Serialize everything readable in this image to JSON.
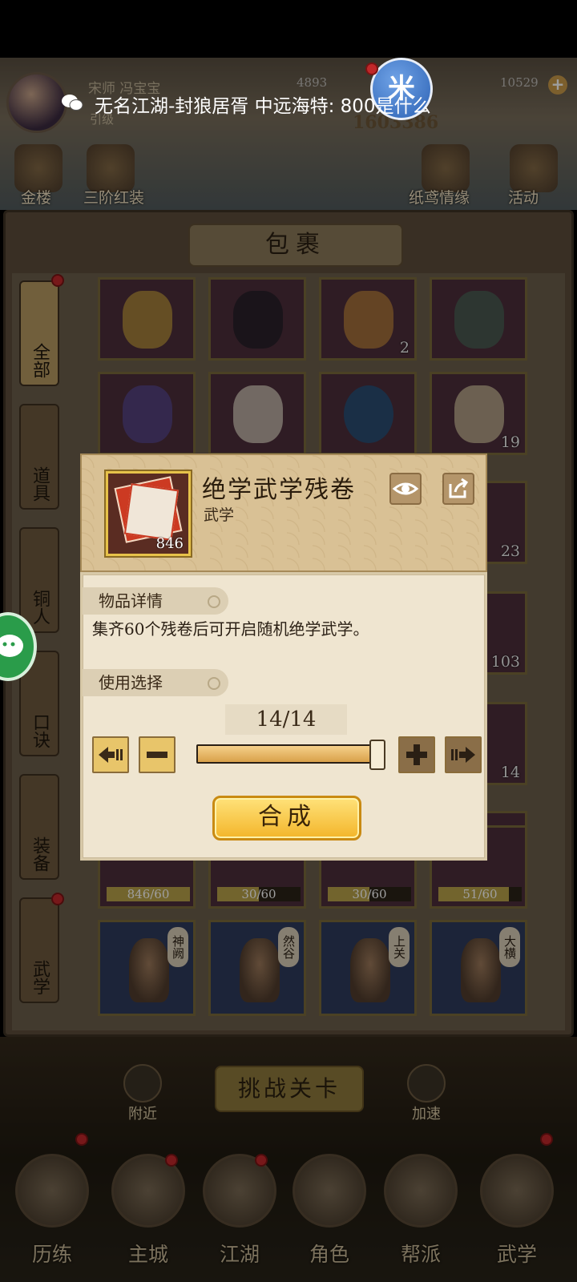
{
  "header": {
    "player_name": "宋师 冯宝宝",
    "player_level": "引级",
    "power": "1603386",
    "coins": "4893",
    "ingots": "10529",
    "float_ball_label": "米",
    "top_icons": [
      "金楼",
      "三阶红装",
      "纸鸢情缘",
      "活动"
    ]
  },
  "notice": {
    "text": "无名江湖-封狼居胥  中远海特: 800是什么"
  },
  "bag": {
    "title": "包裹",
    "tabs": [
      {
        "label": "全部",
        "active": true
      },
      {
        "label": "道具",
        "active": false
      },
      {
        "label": "铜人",
        "active": false
      },
      {
        "label": "口诀",
        "active": false
      },
      {
        "label": "装备",
        "active": false
      },
      {
        "label": "武学",
        "active": false
      }
    ],
    "slots_row1": [
      "",
      "",
      "2",
      ""
    ],
    "slots_row2": [
      "",
      "",
      "",
      "19"
    ],
    "side_counts": [
      "23",
      "103",
      "14"
    ],
    "progress_row": [
      {
        "text": "846/60",
        "fraction": 1.0
      },
      {
        "text": "30/60",
        "fraction": 0.5
      },
      {
        "text": "30/60",
        "fraction": 0.5
      },
      {
        "text": "51/60",
        "fraction": 0.85
      }
    ],
    "statues": [
      "神阙",
      "然谷",
      "上关",
      "大横"
    ]
  },
  "dialog": {
    "item_name": "绝学武学残卷",
    "item_type": "武学",
    "item_count": "846",
    "details_header": "物品详情",
    "description": "集齐60个残卷后可开启随机绝学武学。",
    "use_header": "使用选择",
    "quantity": "14/14",
    "slider_fraction": 1.0,
    "craft_label": "合成"
  },
  "bottom": {
    "challenge_label": "挑战关卡",
    "nearby_label": "附近",
    "speedup_label": "加速",
    "nav": [
      "历练",
      "主城",
      "江湖",
      "角色",
      "帮派",
      "武学"
    ]
  },
  "colors": {
    "craft_button": "#f3b52a",
    "dialog_header": "#d9c195",
    "dialog_body": "#efe5d0",
    "red_dot": "#c0282a"
  }
}
